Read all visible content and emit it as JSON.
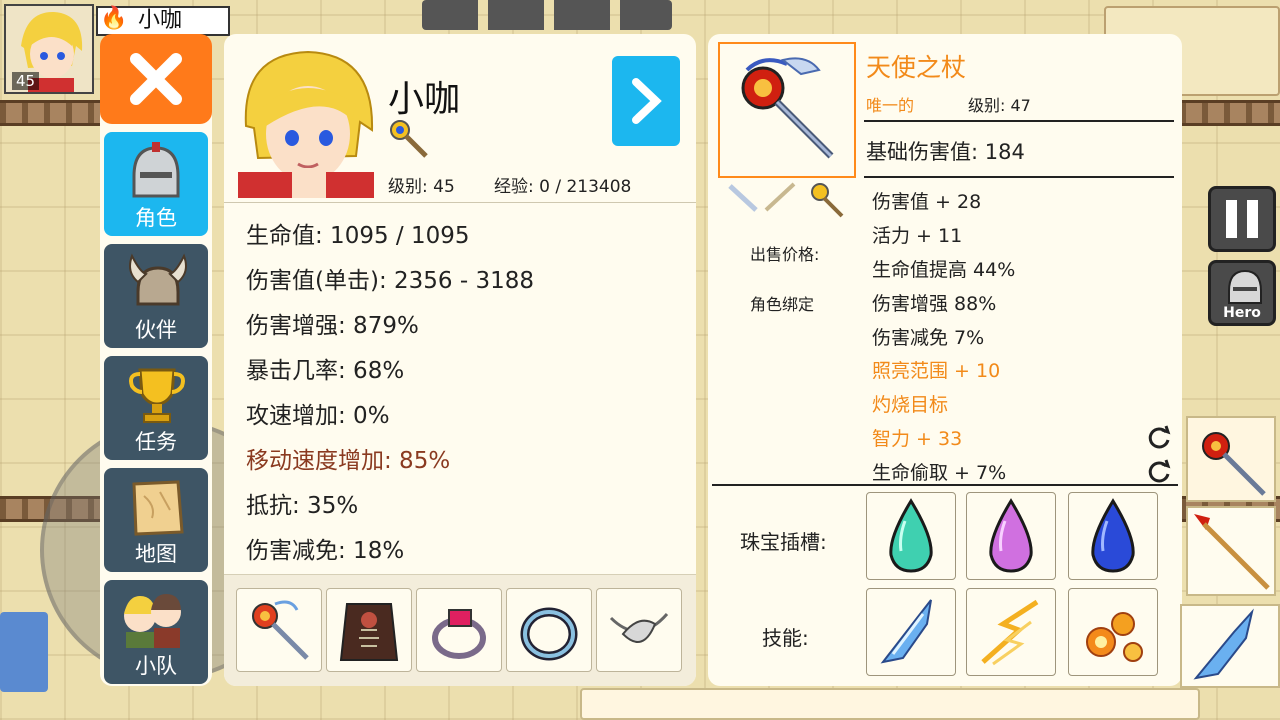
{
  "mini_portrait": {
    "level": "45",
    "name": "小咖"
  },
  "tabs": [
    {
      "label": "角色",
      "icon": "helmet-icon",
      "active": true
    },
    {
      "label": "伙伴",
      "icon": "horned-helmet-icon",
      "active": false
    },
    {
      "label": "任务",
      "icon": "trophy-icon",
      "active": false
    },
    {
      "label": "地图",
      "icon": "map-scroll-icon",
      "active": false
    },
    {
      "label": "小队",
      "icon": "party-icon",
      "active": false
    }
  ],
  "character": {
    "name": "小咖",
    "level_text": "级别: 45",
    "exp_text": "经验: 0 / 213408",
    "stats": [
      {
        "text": "生命值: 1095 / 1095",
        "highlight": false
      },
      {
        "text": "伤害值(单击): 2356 - 3188",
        "highlight": false
      },
      {
        "text": "伤害增强: 879%",
        "highlight": false
      },
      {
        "text": "暴击几率: 68%",
        "highlight": false
      },
      {
        "text": "攻速增加: 0%",
        "highlight": false
      },
      {
        "text": "移动速度增加: 85%",
        "highlight": true
      },
      {
        "text": "抵抗: 35%",
        "highlight": false
      },
      {
        "text": "伤害减免: 18%",
        "highlight": false
      }
    ],
    "equipment": [
      "staff-icon",
      "dark-cloak-icon",
      "ruby-ring-icon",
      "crystal-ring-icon",
      "amulet-icon"
    ]
  },
  "item": {
    "name": "天使之杖",
    "rarity": "唯一的",
    "level_text": "级别: 47",
    "base_damage": "基础伤害值: 184",
    "sell_label": "出售价格:",
    "bind_label": "角色绑定",
    "attributes": [
      {
        "text": "伤害值 + 28",
        "orange": false
      },
      {
        "text": "活力 + 11",
        "orange": false
      },
      {
        "text": "生命值提高 44%",
        "orange": false
      },
      {
        "text": "伤害增强 88%",
        "orange": false
      },
      {
        "text": "伤害减免 7%",
        "orange": false
      },
      {
        "text": "照亮范围 + 10",
        "orange": true
      },
      {
        "text": "灼烧目标",
        "orange": true
      },
      {
        "text": "智力 + 33",
        "orange": true
      },
      {
        "text": "生命偷取 + 7%",
        "orange": false
      }
    ],
    "gem_label": "珠宝插槽:",
    "skill_label": "技能:",
    "gems": [
      {
        "name": "teal-gem-icon",
        "color": "#3fd0b0"
      },
      {
        "name": "pink-gem-icon",
        "color": "#d070e0"
      },
      {
        "name": "blue-gem-icon",
        "color": "#2a4ad8"
      }
    ],
    "skills": [
      "ice-shard-skill-icon",
      "lightning-skill-icon",
      "fireball-skill-icon"
    ]
  },
  "hud": {
    "hero_label": "Hero"
  },
  "colors": {
    "accent_blue": "#1cb7ef",
    "close_orange": "#ff7a1a",
    "item_orange": "#f28a1a",
    "tab_dark": "#3e5565"
  }
}
